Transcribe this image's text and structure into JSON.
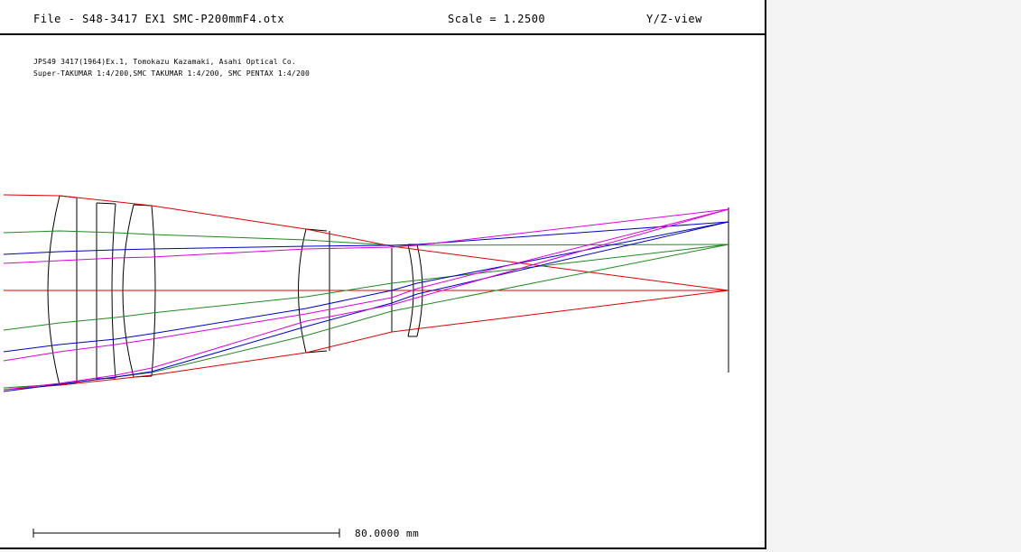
{
  "header": {
    "file": "File - S48-3417 EX1 SMC-P200mmF4.otx",
    "scale": "Scale = 1.2500",
    "view": "Y/Z-view"
  },
  "notes": {
    "line1": "JPS49 3417(1964)Ex.1, Tomokazu Kazamaki, Asahi Optical Co.",
    "line2": "Super-TAKUMAR 1:4/200,SMC TAKUMAR 1:4/200, SMC PENTAX 1:4/200"
  },
  "scale_bar": {
    "label": "80.0000 mm"
  },
  "colors": {
    "lens": "#000000",
    "ray_axial": "#dd0000",
    "ray_field_1": "#228822",
    "ray_field_2": "#0000cc",
    "ray_field_3": "#dd00dd"
  }
}
